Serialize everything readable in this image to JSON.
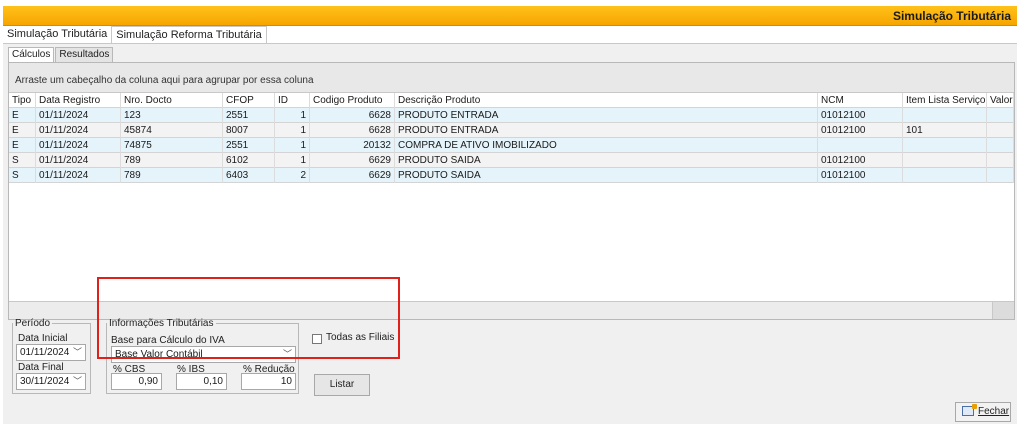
{
  "window": {
    "title": "Simulação Tributária"
  },
  "tabs": [
    {
      "label": "Simulação Tributária",
      "active": false
    },
    {
      "label": "Simulação Reforma Tributária",
      "active": true
    }
  ],
  "subtabs": [
    {
      "label": "Cálculos",
      "active": true
    },
    {
      "label": "Resultados",
      "active": false
    }
  ],
  "grid": {
    "group_hint": "Arraste um cabeçalho da coluna aqui para agrupar por essa coluna",
    "columns": [
      "Tipo",
      "Data Registro",
      "Nro. Docto",
      "CFOP",
      "ID",
      "Codigo Produto",
      "Descrição Produto",
      "NCM",
      "Item Lista Serviço",
      "Valor"
    ],
    "rows": [
      [
        "E",
        "01/11/2024",
        "123",
        "2551",
        "1",
        "6628",
        "PRODUTO ENTRADA",
        "01012100",
        "",
        ""
      ],
      [
        "E",
        "01/11/2024",
        "45874",
        "8007",
        "1",
        "6628",
        "PRODUTO ENTRADA",
        "01012100",
        "101",
        ""
      ],
      [
        "E",
        "01/11/2024",
        "74875",
        "2551",
        "1",
        "20132",
        "COMPRA DE ATIVO IMOBILIZADO",
        "",
        "",
        ""
      ],
      [
        "S",
        "01/11/2024",
        "789",
        "6102",
        "1",
        "6629",
        "PRODUTO SAIDA",
        "01012100",
        "",
        ""
      ],
      [
        "S",
        "01/11/2024",
        "789",
        "6403",
        "2",
        "6629",
        "PRODUTO SAIDA",
        "01012100",
        "",
        ""
      ]
    ]
  },
  "periodo": {
    "legend": "Período",
    "data_inicial_label": "Data Inicial",
    "data_inicial": "01/11/2024",
    "data_final_label": "Data Final",
    "data_final": "30/11/2024"
  },
  "info": {
    "legend": "Informações Tributárias",
    "base_label": "Base para Cálculo do IVA",
    "base_value": "Base Valor Contábil",
    "cbs_label": "% CBS",
    "cbs_value": "0,90",
    "ibs_label": "% IBS",
    "ibs_value": "0,10",
    "reducao_label": "% Redução",
    "reducao_value": "10"
  },
  "todas_filiais": {
    "label": "Todas as Filiais",
    "checked": false
  },
  "listar_label": "Listar",
  "fechar_label": "Fechar",
  "colors": {
    "title_bar": "#f7a400",
    "highlight_border": "#e0201b",
    "row_alt": "#e5f3fb"
  }
}
